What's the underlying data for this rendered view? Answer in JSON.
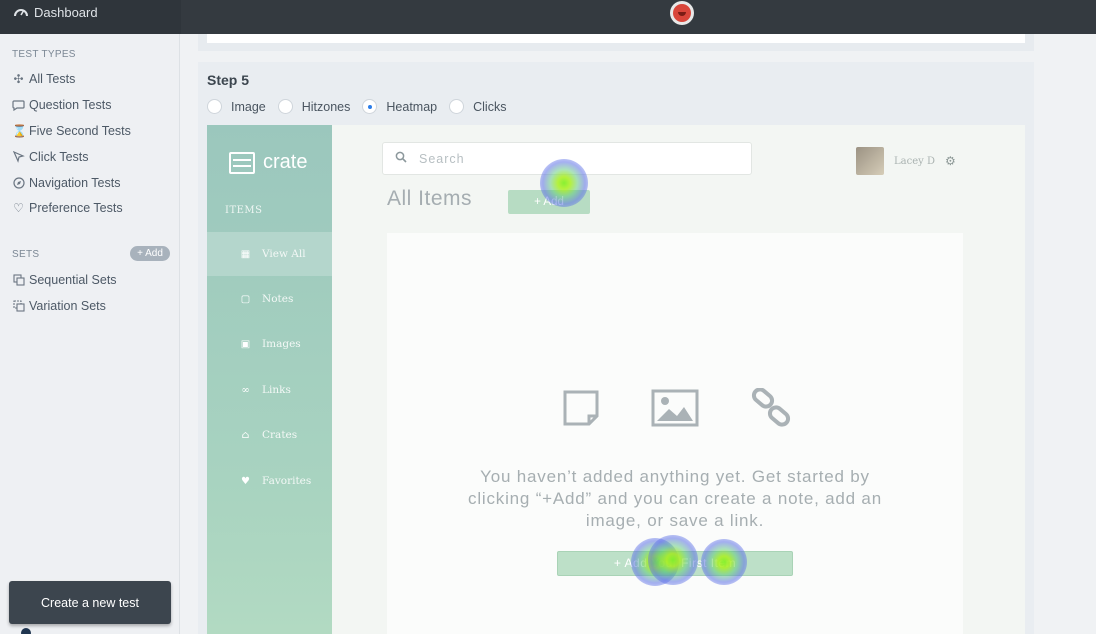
{
  "topbar": {
    "dashboard_label": "Dashboard"
  },
  "sidebar": {
    "test_types_title": "TEST TYPES",
    "test_types": [
      {
        "label": "All Tests",
        "icon": "all-tests-icon"
      },
      {
        "label": "Question Tests",
        "icon": "question-icon"
      },
      {
        "label": "Five Second Tests",
        "icon": "hourglass-icon"
      },
      {
        "label": "Click Tests",
        "icon": "cursor-icon"
      },
      {
        "label": "Navigation Tests",
        "icon": "compass-icon"
      },
      {
        "label": "Preference Tests",
        "icon": "heart-icon"
      }
    ],
    "sets_title": "SETS",
    "add_label": "+ Add",
    "sets": [
      {
        "label": "Sequential Sets",
        "icon": "sequential-icon"
      },
      {
        "label": "Variation Sets",
        "icon": "variation-icon"
      }
    ],
    "create_label": "Create a new test"
  },
  "step": {
    "title": "Step 5",
    "modes": [
      "Image",
      "Hitzones",
      "Heatmap",
      "Clicks"
    ],
    "selected_mode": "Heatmap"
  },
  "preview": {
    "brand": "crate",
    "section_label": "ITEMS",
    "nav": [
      "View All",
      "Notes",
      "Images",
      "Links",
      "Crates",
      "Favorites"
    ],
    "active_nav": "View All",
    "search_placeholder": "Search",
    "user_name": "Lacey D",
    "page_title": "All Items",
    "add_label": "+ Add",
    "empty_message": "You haven’t added anything yet. Get started by clicking “+Add” and you can create a note, add an image, or save a link.",
    "first_item_label": "+ Add Your First Item"
  },
  "colors": {
    "heat_hot": "#82f028",
    "heat_cool": "#6a6ee6",
    "sidebar_accent": "#9bc7bd"
  }
}
